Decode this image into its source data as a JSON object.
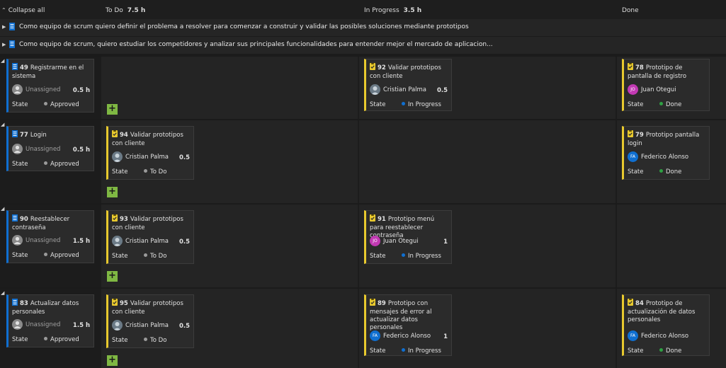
{
  "header": {
    "collapse_label": "Collapse all",
    "columns": [
      {
        "name": "To Do",
        "total": "7.5 h"
      },
      {
        "name": "In Progress",
        "total": "3.5 h"
      },
      {
        "name": "Done",
        "total": ""
      }
    ]
  },
  "parents": [
    {
      "title": "Como equipo de scrum quiero definir el problema a resolver para comenzar a construir y validar las posibles soluciones mediante prototipos"
    },
    {
      "title": "Como equipo de scrum, quiero estudiar los competidores y analizar sus principales funcionalidades para entender mejor el mercado de aplicacion..."
    }
  ],
  "state_label": "State",
  "colors": {
    "story_accent": "#0f6fd1",
    "task_accent": "#e8c92e",
    "approved_dot": "#9a9a9a",
    "todo_dot": "#9a9a9a",
    "in_progress_dot": "#0f6fd1",
    "done_dot": "#2ea043",
    "add_button": "#7fb843"
  },
  "lanes": [
    {
      "story": {
        "id": "49",
        "title": "Registrarme en el sistema",
        "assignee": "Unassigned",
        "estimate": "0.5 h",
        "state": "Approved"
      },
      "todo": null,
      "in_progress": {
        "id": "92",
        "title": "Validar prototipos con cliente",
        "assignee": "Cristian Palma",
        "initials": "",
        "estimate": "0.5",
        "state": "In Progress"
      },
      "done": {
        "id": "78",
        "title": "Prototipo de pantalla de registro",
        "assignee": "Juan Otegui",
        "initials": "JO",
        "estimate": "",
        "state": "Done"
      }
    },
    {
      "story": {
        "id": "77",
        "title": "Login",
        "assignee": "Unassigned",
        "estimate": "0.5 h",
        "state": "Approved"
      },
      "todo": {
        "id": "94",
        "title": "Validar prototipos con cliente",
        "assignee": "Cristian Palma",
        "initials": "",
        "estimate": "0.5",
        "state": "To Do"
      },
      "in_progress": null,
      "done": {
        "id": "79",
        "title": "Prototipo pantalla login",
        "assignee": "Federico Alonso",
        "initials": "FA",
        "estimate": "",
        "state": "Done"
      }
    },
    {
      "story": {
        "id": "90",
        "title": "Reestablecer contraseña",
        "assignee": "Unassigned",
        "estimate": "1.5 h",
        "state": "Approved"
      },
      "todo": {
        "id": "93",
        "title": "Validar prototipos con cliente",
        "assignee": "Cristian Palma",
        "initials": "",
        "estimate": "0.5",
        "state": "To Do"
      },
      "in_progress": {
        "id": "91",
        "title": "Prototipo menú para reestablecer contraseña",
        "assignee": "Juan Otegui",
        "initials": "JO",
        "estimate": "1",
        "state": "In Progress"
      },
      "done": null
    },
    {
      "story": {
        "id": "83",
        "title": "Actualizar datos personales",
        "assignee": "Unassigned",
        "estimate": "1.5 h",
        "state": "Approved"
      },
      "todo": {
        "id": "95",
        "title": "Validar prototipos con cliente",
        "assignee": "Cristian Palma",
        "initials": "",
        "estimate": "0.5",
        "state": "To Do"
      },
      "in_progress": {
        "id": "89",
        "title": "Prototipo con mensajes de error al actualizar datos personales",
        "assignee": "Federico Alonso",
        "initials": "FA",
        "estimate": "1",
        "state": "In Progress"
      },
      "done": {
        "id": "84",
        "title": "Prototipo de actualización de datos personales",
        "assignee": "Federico Alonso",
        "initials": "FA",
        "estimate": "",
        "state": "Done"
      }
    }
  ]
}
